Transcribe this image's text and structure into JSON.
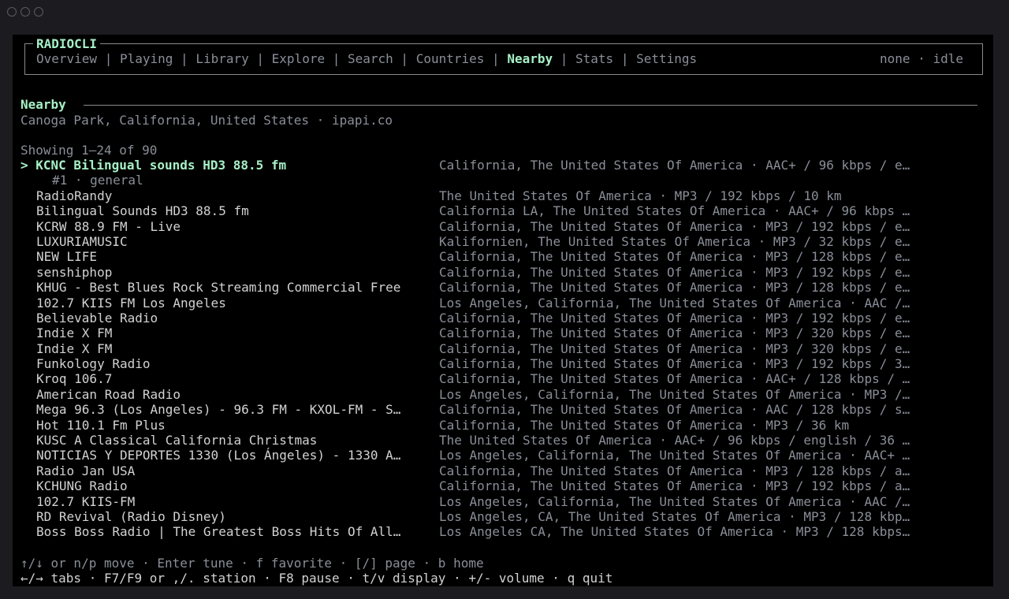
{
  "app": {
    "title": "RADIOCLI",
    "status": "none · idle"
  },
  "tabs": [
    {
      "label": "Overview",
      "active": false
    },
    {
      "label": "Playing",
      "active": false
    },
    {
      "label": "Library",
      "active": false
    },
    {
      "label": "Explore",
      "active": false
    },
    {
      "label": "Search",
      "active": false
    },
    {
      "label": "Countries",
      "active": false
    },
    {
      "label": "Nearby",
      "active": true
    },
    {
      "label": "Stats",
      "active": false
    },
    {
      "label": "Settings",
      "active": false
    }
  ],
  "section": {
    "title": "Nearby",
    "location": "Canoga Park, California, United States · ipapi.co",
    "showing": "Showing 1–24 of 90"
  },
  "selected": {
    "name": "> KCNC Bilingual sounds HD3 88.5 fm",
    "meta": "California, The United States Of America · AAC+ / 96 kbps / e…",
    "sub": "#1 · general"
  },
  "stations": [
    {
      "name": "RadioRandy",
      "meta": "The United States Of America · MP3 / 192 kbps / 10 km"
    },
    {
      "name": "Bilingual Sounds HD3 88.5 fm",
      "meta": "California LA, The United States Of America · AAC+ / 96 kbps …"
    },
    {
      "name": "KCRW 88.9 FM - Live",
      "meta": "California, The United States Of America · MP3 / 192 kbps / e…"
    },
    {
      "name": "LUXURIAMUSIC",
      "meta": "Kalifornien, The United States Of America · MP3 / 32 kbps / e…"
    },
    {
      "name": "NEW LIFE",
      "meta": "California, The United States Of America · MP3 / 128 kbps / e…"
    },
    {
      "name": "senshiphop",
      "meta": "California, The United States Of America · MP3 / 192 kbps / e…"
    },
    {
      "name": "KHUG - Best Blues Rock Streaming Commercial Free",
      "meta": "California, The United States Of America · MP3 / 128 kbps / e…"
    },
    {
      "name": "102.7 KIIS FM Los Angeles",
      "meta": "Los Angeles, California, The United States Of America · AAC /…"
    },
    {
      "name": "Believable Radio",
      "meta": "California, The United States Of America · MP3 / 192 kbps / e…"
    },
    {
      "name": "Indie X FM",
      "meta": "California, The United States Of America · MP3 / 320 kbps / e…"
    },
    {
      "name": "Indie X FM",
      "meta": "California, The United States Of America · MP3 / 320 kbps / e…"
    },
    {
      "name": "Funkology Radio",
      "meta": "California, The United States Of America · MP3 / 192 kbps / 3…"
    },
    {
      "name": "Kroq 106.7",
      "meta": "California, The United States Of America · AAC+ / 128 kbps / …"
    },
    {
      "name": "American Road Radio",
      "meta": "Los Angeles, California, The United States Of America · MP3 /…"
    },
    {
      "name": "Mega 96.3 (Los Angeles) - 96.3 FM - KXOL-FM - S…",
      "meta": "California, The United States Of America · AAC / 128 kbps / s…"
    },
    {
      "name": "Hot 110.1 Fm Plus",
      "meta": "California, The United States Of America · MP3 / 36 km"
    },
    {
      "name": "KUSC A Classical California Christmas",
      "meta": "The United States Of America · AAC+ / 96 kbps / english / 36 …"
    },
    {
      "name": "NOTICIAS Y DEPORTES 1330 (Los Ángeles) - 1330 A…",
      "meta": "Los Angeles, California, The United States Of America · AAC+ …"
    },
    {
      "name": "Radio Jan USA",
      "meta": "California, The United States Of America · MP3 / 128 kbps / a…"
    },
    {
      "name": "KCHUNG Radio",
      "meta": "California, The United States Of America · MP3 / 192 kbps / a…"
    },
    {
      "name": "102.7 KIIS-FM",
      "meta": "Los Angeles, California, The United States Of America · AAC /…"
    },
    {
      "name": "RD Revival (Radio Disney)",
      "meta": "Los Angeles, CA, The United States Of America · MP3 / 128 kbp…"
    },
    {
      "name": "Boss Boss Radio | The Greatest Boss Hits Of All…",
      "meta": "Los Angeles CA, The United States Of America · MP3 / 128 kbps…"
    }
  ],
  "footer": {
    "line1": "↑/↓ or n/p move · Enter tune · f favorite · [/] page · b home",
    "line2": "←/→ tabs · F7/F9 or ,/. station · F8 pause · t/v display · +/- volume · q quit"
  },
  "colors": {
    "accent": "#a6f0c6",
    "muted": "#8a8e98",
    "text": "#d2d2d2",
    "background": "#000000"
  }
}
